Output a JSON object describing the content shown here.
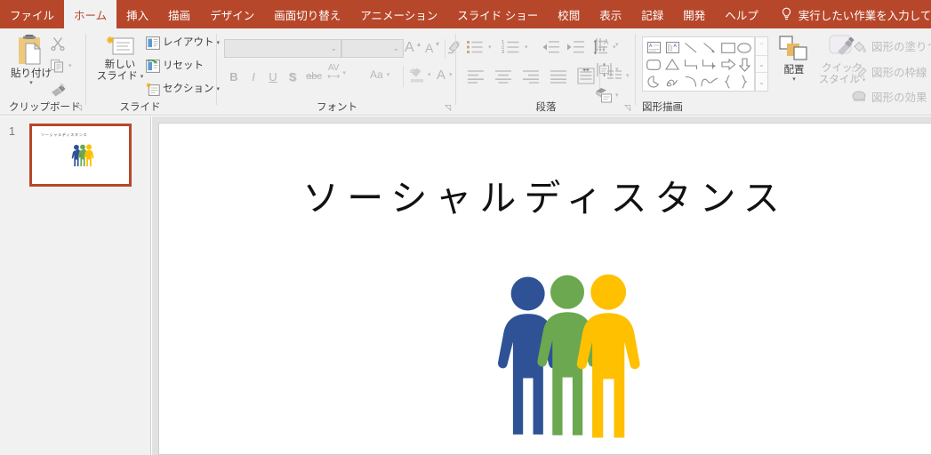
{
  "app": {
    "accent_color": "#b7472a",
    "ribbon_bg": "#f1f1f1"
  },
  "tabs": [
    {
      "label": "ファイル",
      "active": false,
      "name": "tab-file"
    },
    {
      "label": "ホーム",
      "active": true,
      "name": "tab-home"
    },
    {
      "label": "挿入",
      "active": false,
      "name": "tab-insert"
    },
    {
      "label": "描画",
      "active": false,
      "name": "tab-draw"
    },
    {
      "label": "デザイン",
      "active": false,
      "name": "tab-design"
    },
    {
      "label": "画面切り替え",
      "active": false,
      "name": "tab-transitions"
    },
    {
      "label": "アニメーション",
      "active": false,
      "name": "tab-animations"
    },
    {
      "label": "スライド ショー",
      "active": false,
      "name": "tab-slideshow"
    },
    {
      "label": "校閲",
      "active": false,
      "name": "tab-review"
    },
    {
      "label": "表示",
      "active": false,
      "name": "tab-view"
    },
    {
      "label": "記録",
      "active": false,
      "name": "tab-record"
    },
    {
      "label": "開発",
      "active": false,
      "name": "tab-developer"
    },
    {
      "label": "ヘルプ",
      "active": false,
      "name": "tab-help"
    }
  ],
  "tell_me": {
    "label": "実行したい作業を入力してください",
    "icon": "lightbulb-icon"
  },
  "ribbon": {
    "groups": {
      "clipboard": {
        "label": "クリップボード",
        "paste_label_line1": "貼り付け",
        "cut_icon": "scissors-icon",
        "copy_icon": "copy-icon",
        "format_painter_icon": "format-painter-icon",
        "paste_icon": "clipboard-icon",
        "dialog_launcher": "◹"
      },
      "slide": {
        "label": "スライド",
        "new_slide_line1": "新しい",
        "new_slide_line2": "スライド",
        "new_slide_icon": "new-slide-icon",
        "layout_label": "レイアウト",
        "layout_icon": "layout-icon",
        "reset_label": "リセット",
        "reset_icon": "reset-icon",
        "section_label": "セクション",
        "section_icon": "section-icon"
      },
      "font": {
        "label": "フォント",
        "font_name_value": "",
        "font_name_placeholder": "",
        "font_size_value": "",
        "grow_font": "A",
        "shrink_font": "A",
        "clear_formatting_icon": "clear-format-icon",
        "bold": "B",
        "italic": "I",
        "underline": "U",
        "shadow": "S",
        "strikethrough": "abc",
        "char_spacing": "AV",
        "change_case": "Aa",
        "highlight_icon": "text-highlight-icon",
        "font_color": "A",
        "dialog_launcher": "◹"
      },
      "paragraph": {
        "label": "段落",
        "bullets_icon": "bullet-list-icon",
        "numbering_icon": "numbered-list-icon",
        "decrease_indent_icon": "decrease-indent-icon",
        "increase_indent_icon": "increase-indent-icon",
        "line_spacing_icon": "line-spacing-icon",
        "text_direction_icon": "text-direction-icon",
        "align_text_icon": "align-text-icon",
        "smartart_icon": "smartart-icon",
        "align_left_icon": "align-left-icon",
        "align_center_icon": "align-center-icon",
        "align_right_icon": "align-right-icon",
        "justify_icon": "justify-icon",
        "columns_icon": "columns-icon",
        "dialog_launcher": "◹"
      },
      "drawing": {
        "label": "図形描画",
        "arrange_label": "配置",
        "arrange_icon": "arrange-icon",
        "quick_styles_line1": "クイック",
        "quick_styles_line2": "スタイル",
        "quick_styles_icon": "quick-styles-icon",
        "shape_fill_label": "図形の塗りつぶ",
        "shape_fill_icon": "shape-fill-icon",
        "shape_outline_label": "図形の枠線",
        "shape_outline_icon": "shape-outline-icon",
        "shape_effects_label": "図形の効果",
        "shape_effects_icon": "shape-effects-icon",
        "scroll_up_icon": "chevron-up-icon",
        "scroll_down_icon": "chevron-down-icon",
        "more_shapes_icon": "more-shapes-icon",
        "shapes": [
          "textbox-icon",
          "vertical-textbox-icon",
          "line-icon",
          "arrow-icon",
          "rectangle-icon",
          "ellipse-icon",
          "rounded-rectangle-icon",
          "triangle-icon",
          "elbow-connector-icon",
          "elbow-arrow-connector-icon",
          "right-arrow-icon",
          "down-arrow-icon",
          "pie-icon",
          "freeform-scribble-icon",
          "arc-icon",
          "double-arc-icon",
          "left-brace-icon",
          "right-brace-icon"
        ]
      }
    }
  },
  "slide_panel": {
    "slides": [
      {
        "number": "1",
        "selected": true,
        "title": "ソーシャルディスタンス",
        "art": "three-people-icon"
      }
    ]
  },
  "slide": {
    "title": "ソーシャルディスタンス",
    "art_name": "three-people-graphic",
    "art_colors": {
      "blue": "#2e5295",
      "green": "#6ba84f",
      "yellow": "#ffc000"
    }
  }
}
